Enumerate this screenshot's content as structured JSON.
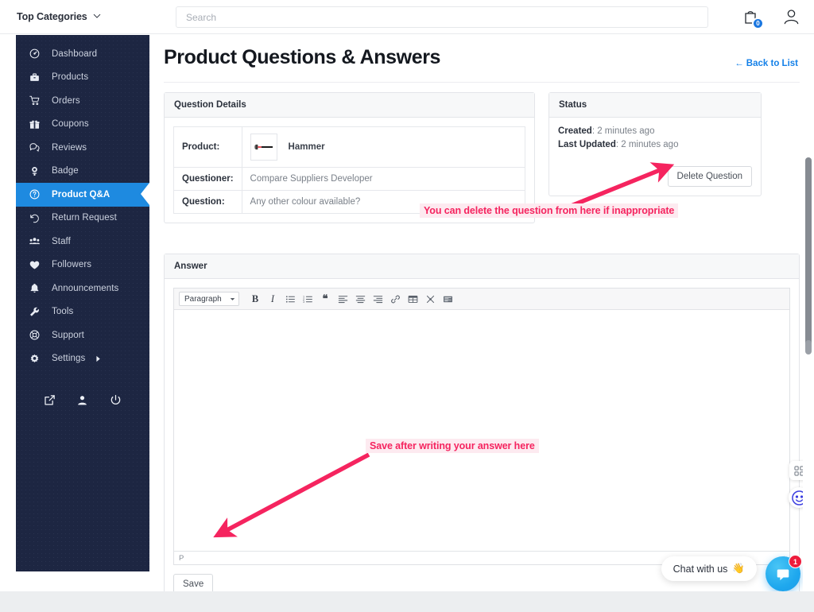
{
  "topbar": {
    "categories_label": "Top Categories",
    "categories_icon": "chevron-down-icon",
    "search_placeholder": "Search",
    "search_value": "",
    "cart_icon": "shopping-bag-icon",
    "cart_count": "0",
    "account_icon": "user-icon"
  },
  "sidebar": {
    "items": [
      {
        "label": "Dashboard",
        "icon": "dashboard-icon",
        "active": false
      },
      {
        "label": "Products",
        "icon": "briefcase-icon",
        "active": false
      },
      {
        "label": "Orders",
        "icon": "cart-icon",
        "active": false
      },
      {
        "label": "Coupons",
        "icon": "gift-icon",
        "active": false
      },
      {
        "label": "Reviews",
        "icon": "comments-icon",
        "active": false
      },
      {
        "label": "Badge",
        "icon": "award-icon",
        "active": false
      },
      {
        "label": "Product Q&A",
        "icon": "question-circle-icon",
        "active": true
      },
      {
        "label": "Return Request",
        "icon": "undo-icon",
        "active": false
      },
      {
        "label": "Staff",
        "icon": "users-icon",
        "active": false
      },
      {
        "label": "Followers",
        "icon": "heart-icon",
        "active": false
      },
      {
        "label": "Announcements",
        "icon": "bell-icon",
        "active": false
      },
      {
        "label": "Tools",
        "icon": "wrench-icon",
        "active": false
      },
      {
        "label": "Support",
        "icon": "lifebuoy-icon",
        "active": false
      },
      {
        "label": "Settings",
        "icon": "gear-icon",
        "active": false,
        "caret": "caret-right-icon"
      }
    ],
    "footer_icons": [
      "external-link-icon",
      "user-icon",
      "power-icon"
    ]
  },
  "page": {
    "title": "Product Questions & Answers",
    "back_link": "← Back to List"
  },
  "question_details": {
    "card_title": "Question Details",
    "rows": [
      {
        "label": "Product:",
        "value": "Hammer",
        "has_thumb": true
      },
      {
        "label": "Questioner:",
        "value": "Compare Suppliers Developer",
        "has_thumb": false
      },
      {
        "label": "Question:",
        "value": "Any other colour available?",
        "has_thumb": false
      }
    ],
    "product_thumb_icon": "hammer-product-image"
  },
  "status": {
    "card_title": "Status",
    "created_label": "Created",
    "created_value": ": 2 minutes ago",
    "updated_label": "Last Updated",
    "updated_value": ": 2 minutes ago",
    "delete_button": "Delete Question"
  },
  "answer": {
    "card_title": "Answer",
    "editor": {
      "format_select": "Paragraph",
      "toolbar_buttons": [
        {
          "name": "bold-button",
          "glyph": "B",
          "kind": "bold"
        },
        {
          "name": "italic-button",
          "glyph": "I",
          "kind": "ital"
        },
        {
          "name": "bullet-list-button",
          "glyph": "",
          "kind": "ul"
        },
        {
          "name": "numbered-list-button",
          "glyph": "",
          "kind": "ol"
        },
        {
          "name": "blockquote-button",
          "glyph": "❝",
          "kind": "quote"
        },
        {
          "name": "align-left-button",
          "glyph": "",
          "kind": "alignleft"
        },
        {
          "name": "align-center-button",
          "glyph": "",
          "kind": "aligncenter"
        },
        {
          "name": "align-right-button",
          "glyph": "",
          "kind": "alignright"
        },
        {
          "name": "insert-link-button",
          "glyph": "",
          "kind": "link"
        },
        {
          "name": "insert-table-button",
          "glyph": "",
          "kind": "table"
        },
        {
          "name": "unlink-button",
          "glyph": "",
          "kind": "unlink"
        },
        {
          "name": "source-code-button",
          "glyph": "",
          "kind": "code"
        }
      ],
      "content": "",
      "status_path": "P"
    },
    "save_button": "Save"
  },
  "annotations": [
    {
      "text": "You can delete the question from here if inappropriate"
    },
    {
      "text": "Save after writing your answer here"
    }
  ],
  "chat": {
    "bubble_text": "Chat with us",
    "bubble_emoji": "👋",
    "button_icon": "chat-message-icon",
    "unread_count": "1"
  },
  "float_icons": [
    {
      "name": "apps-grid-icon"
    },
    {
      "name": "smiley-face-icon"
    }
  ],
  "colors": {
    "sidebar_bg": "#1d2642",
    "active_nav": "#1e8ae0",
    "link_blue": "#1480e8",
    "annotation_pink": "#f5245f",
    "annotation_bg": "#fdeaf0",
    "chat_blue": "#1fa8ee",
    "badge_red": "#ed1c3c"
  }
}
